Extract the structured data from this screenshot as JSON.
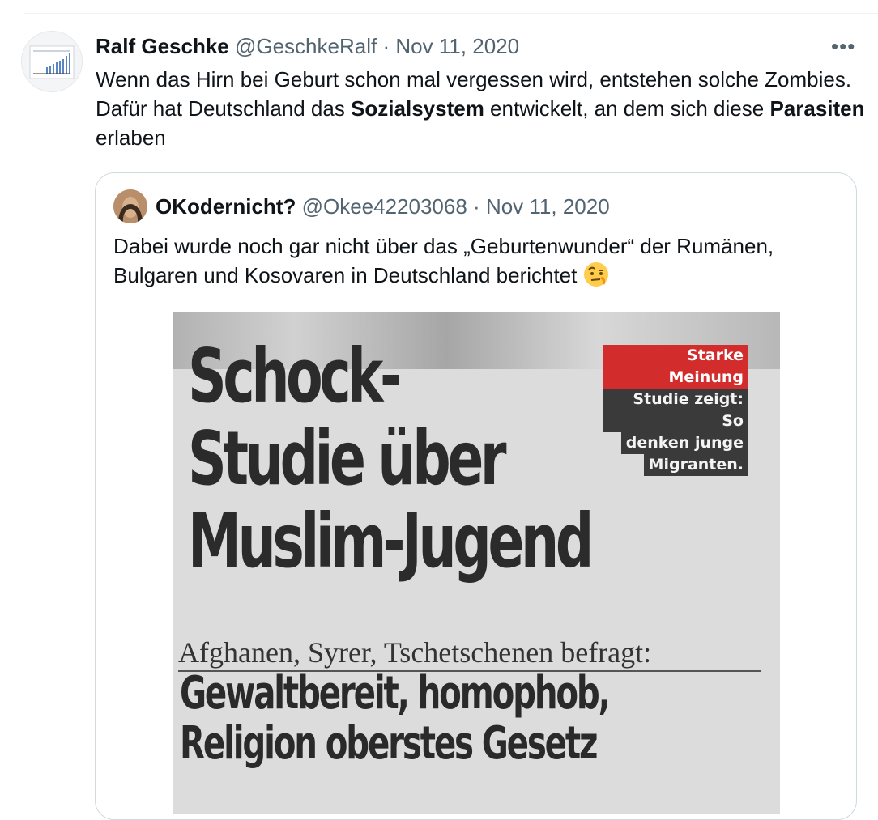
{
  "tweet": {
    "display_name": "Ralf Geschke",
    "handle": "@GeschkeRalf",
    "separator": "·",
    "date": "Nov 11, 2020",
    "more_label": "•••",
    "text_parts": {
      "p1": "Wenn das Hirn bei Geburt schon mal vergessen wird, entstehen solche Zombies. Dafür hat Deutschland das ",
      "b1": "Sozialsystem",
      "p2": " entwickelt, an dem sich diese ",
      "b2": "Parasiten",
      "p3": " erlaben"
    }
  },
  "quoted": {
    "display_name": "OKodernicht?",
    "handle": "@Okee42203068",
    "separator": "·",
    "date": "Nov 11, 2020",
    "text": "Dabei wurde noch gar nicht über das „Geburtenwunder“ der Rumänen, Bulgaren und Kosovaren in Deutschland berichtet",
    "emoji": "face-with-raised-eyebrow",
    "image": {
      "badge_red": "Starke Meinung",
      "badge_lines": [
        "Studie zeigt: So",
        "denken junge",
        "Migranten."
      ],
      "headline_lines": [
        "Schock-",
        "Studie über",
        "Muslim-Jugend"
      ],
      "subhead": "Afghanen, Syrer, Tschetschenen befragt:",
      "deck_lines": [
        "Gewaltbereit, homophob,",
        "Religion oberstes Gesetz"
      ]
    }
  }
}
